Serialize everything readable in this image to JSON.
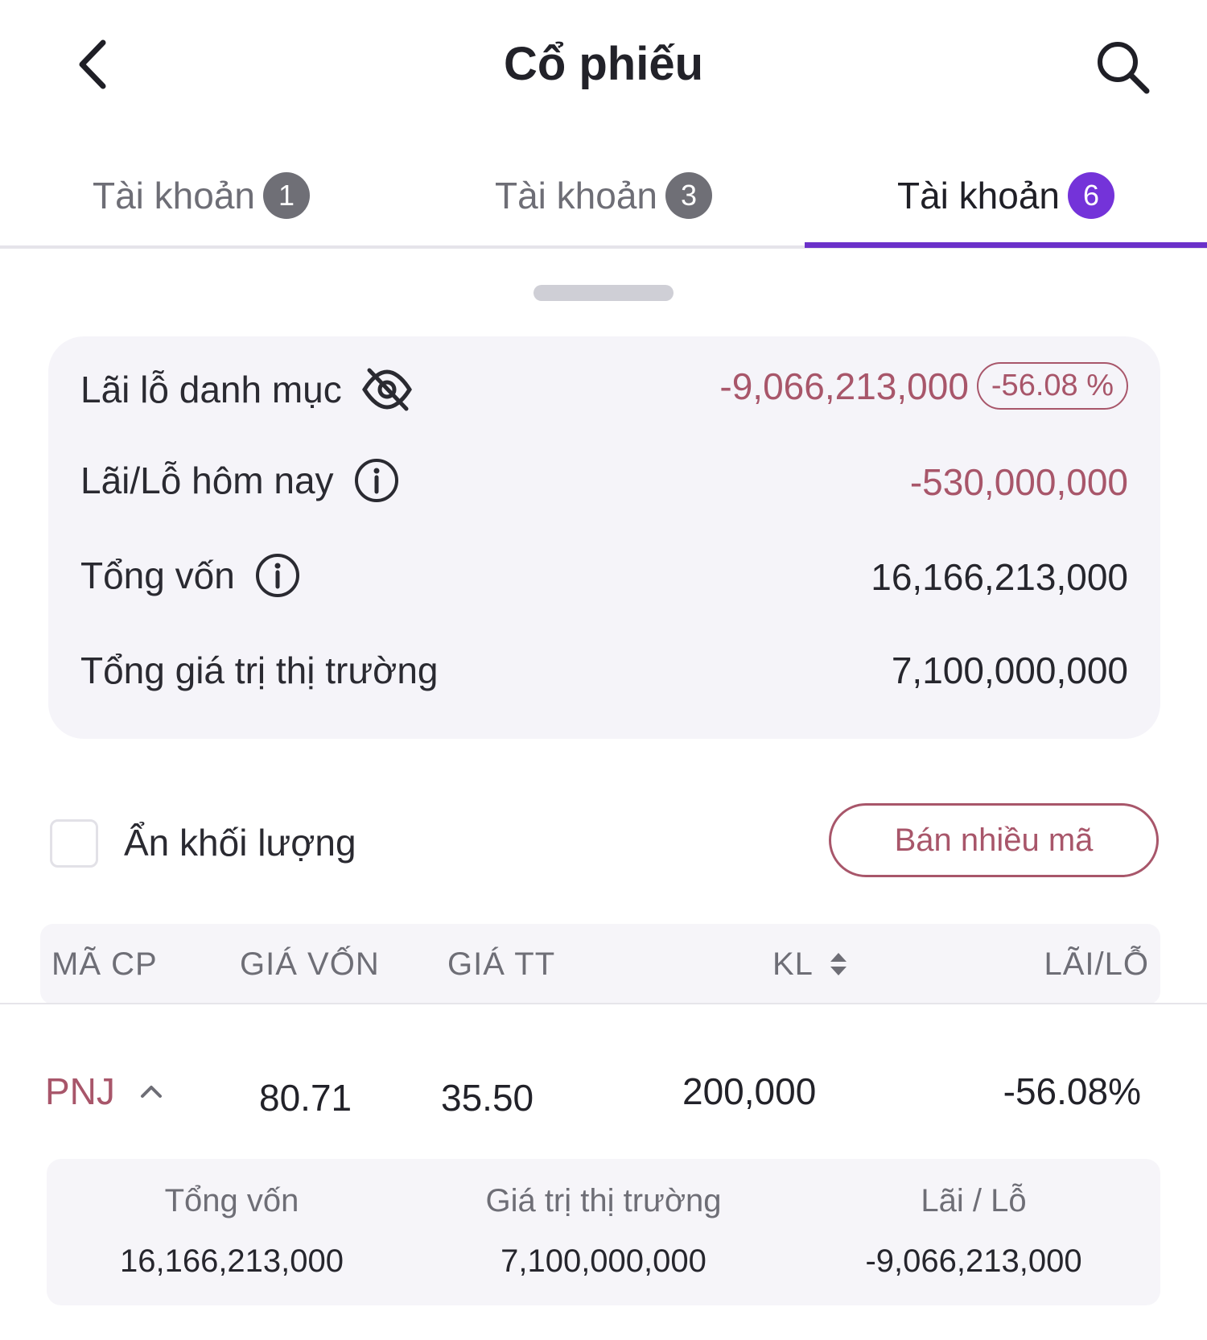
{
  "header": {
    "title": "Cổ phiếu",
    "back_icon": "chevron-left-icon",
    "search_icon": "search-icon"
  },
  "tabs": [
    {
      "label": "Tài khoản",
      "badge": "1",
      "active": false
    },
    {
      "label": "Tài khoản",
      "badge": "3",
      "active": false
    },
    {
      "label": "Tài khoản",
      "badge": "6",
      "active": true
    }
  ],
  "summary": {
    "portfolio_pl": {
      "label": "Lãi lỗ danh mục",
      "value": "-9,066,213,000",
      "percent": "-56.08 %"
    },
    "today_pl": {
      "label": "Lãi/Lỗ hôm nay",
      "value": "-530,000,000"
    },
    "total_capital": {
      "label": "Tổng vốn",
      "value": "16,166,213,000"
    },
    "total_market_value": {
      "label": "Tổng giá trị thị trường",
      "value": "7,100,000,000"
    }
  },
  "controls": {
    "hide_volume_label": "Ẩn khối lượng",
    "hide_volume_checked": false,
    "sell_multiple_label": "Bán nhiều mã"
  },
  "table": {
    "headers": {
      "ticker": "MÃ CP",
      "cost_price": "GIÁ VỐN",
      "market_price": "GIÁ TT",
      "volume": "KL",
      "pl": "LÃI/LỖ"
    },
    "row": {
      "ticker": "PNJ",
      "cost_price": "80.71",
      "market_price": "35.50",
      "volume": "200,000",
      "pl": "-56.08%"
    },
    "detail": {
      "capital_label": "Tổng vốn",
      "capital_value": "16,166,213,000",
      "market_value_label": "Giá trị thị trường",
      "market_value_value": "7,100,000,000",
      "pl_label": "Lãi / Lỗ",
      "pl_value": "-9,066,213,000"
    }
  },
  "colors": {
    "accent": "#7433d9",
    "negative": "#a8566a",
    "card_bg": "#f5f4f9"
  }
}
